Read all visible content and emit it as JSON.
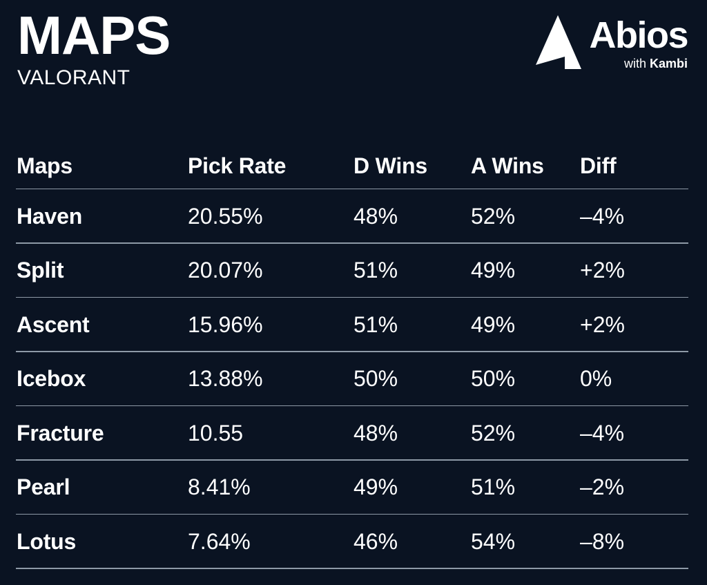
{
  "header": {
    "title": "MAPS",
    "subtitle": "VALORANT"
  },
  "logo": {
    "mark_icon": "abios-arrow-icon",
    "wordmark": "Abios",
    "tagline_prefix": "with ",
    "tagline_brand": "Kambi"
  },
  "colors": {
    "background": "#0a1322",
    "text": "#ffffff",
    "divider": "#8e9aa7"
  },
  "table": {
    "columns": [
      "Maps",
      "Pick Rate",
      "D Wins",
      "A Wins",
      "Diff"
    ],
    "rows": [
      {
        "map": "Haven",
        "pick_rate": "20.55%",
        "d_wins": "48%",
        "a_wins": "52%",
        "diff": "–4%"
      },
      {
        "map": "Split",
        "pick_rate": "20.07%",
        "d_wins": "51%",
        "a_wins": "49%",
        "diff": "+2%"
      },
      {
        "map": "Ascent",
        "pick_rate": "15.96%",
        "d_wins": "51%",
        "a_wins": "49%",
        "diff": "+2%"
      },
      {
        "map": "Icebox",
        "pick_rate": "13.88%",
        "d_wins": "50%",
        "a_wins": "50%",
        "diff": "0%"
      },
      {
        "map": "Fracture",
        "pick_rate": "10.55",
        "d_wins": "48%",
        "a_wins": "52%",
        "diff": "–4%"
      },
      {
        "map": "Pearl",
        "pick_rate": "8.41%",
        "d_wins": "49%",
        "a_wins": "51%",
        "diff": "–2%"
      },
      {
        "map": "Lotus",
        "pick_rate": "7.64%",
        "d_wins": "46%",
        "a_wins": "54%",
        "diff": "–8%"
      }
    ]
  },
  "chart_data": {
    "type": "table",
    "title": "MAPS",
    "subtitle": "VALORANT",
    "columns": [
      "Maps",
      "Pick Rate",
      "D Wins",
      "A Wins",
      "Diff"
    ],
    "categories": [
      "Haven",
      "Split",
      "Ascent",
      "Icebox",
      "Fracture",
      "Pearl",
      "Lotus"
    ],
    "series": [
      {
        "name": "Pick Rate",
        "values": [
          20.55,
          20.07,
          15.96,
          13.88,
          10.55,
          8.41,
          7.64
        ],
        "unit": "%"
      },
      {
        "name": "D Wins",
        "values": [
          48,
          51,
          51,
          50,
          48,
          49,
          46
        ],
        "unit": "%"
      },
      {
        "name": "A Wins",
        "values": [
          52,
          49,
          49,
          50,
          52,
          51,
          54
        ],
        "unit": "%"
      },
      {
        "name": "Diff",
        "values": [
          -4,
          2,
          2,
          0,
          -4,
          -2,
          -8
        ],
        "unit": "%"
      }
    ]
  }
}
